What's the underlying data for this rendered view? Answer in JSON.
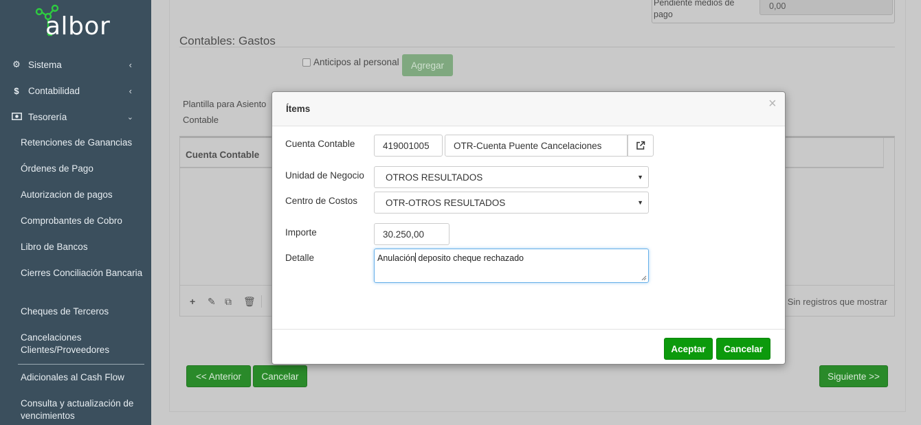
{
  "brand": {
    "name": "albor"
  },
  "sidebar": {
    "items": [
      {
        "label": "Sistema",
        "icon": "gears-icon"
      },
      {
        "label": "Contabilidad",
        "icon": "dollar-icon"
      },
      {
        "label": "Tesorería",
        "icon": "money-icon"
      }
    ],
    "subitems": [
      "Retenciones de Ganancias",
      "Órdenes de Pago",
      "Autorizacion de pagos",
      "Comprobantes de Cobro",
      "Libro de Bancos",
      "Cierres Conciliación Bancaria",
      "Cheques de Terceros",
      "Cancelaciones Clientes/Proveedores",
      "Adicionales al Cash Flow",
      "Consulta y actualización de vencimientos"
    ]
  },
  "main": {
    "pendiente_label": "Pendiente medios de pago",
    "pendiente_value": "0,00",
    "section_title": "Contables: Gastos",
    "anticipos_label": "Anticipos al personal",
    "agregar_label": "Agregar",
    "plantilla_label": "Plantilla para Asiento Contable",
    "grid_header": "Cuenta Contable",
    "no_records": "Sin registros que mostrar",
    "anterior_label": "<< Anterior",
    "cancelar_label": "Cancelar",
    "siguiente_label": "Siguiente >>"
  },
  "modal": {
    "title": "Ítems",
    "cuenta_label": "Cuenta Contable",
    "cuenta_code": "419001005",
    "cuenta_name": "OTR-Cuenta Puente Cancelaciones",
    "unidad_label": "Unidad de Negocio",
    "unidad_value": "OTROS RESULTADOS",
    "centro_label": "Centro de Costos",
    "centro_value": "OTR-OTROS RESULTADOS",
    "importe_label": "Importe",
    "importe_value": "30.250,00",
    "detalle_label": "Detalle",
    "detalle_before": "Anulación",
    "detalle_after": "deposito cheque rechazado",
    "aceptar_label": "Aceptar",
    "cancelar_label": "Cancelar"
  },
  "colors": {
    "sidebar": "#3b4f5d",
    "accent_green": "#0c9a0c",
    "logo_green": "#2ecc40"
  }
}
